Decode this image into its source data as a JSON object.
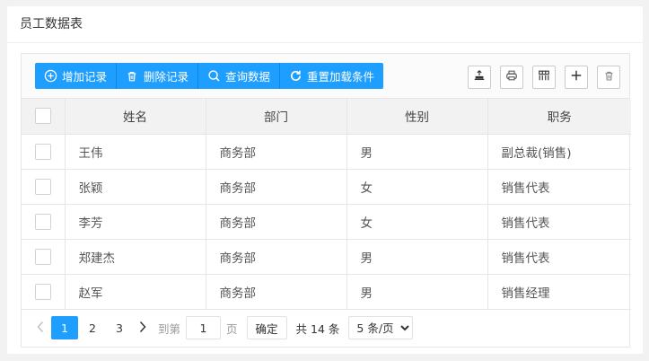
{
  "card": {
    "title": "员工数据表"
  },
  "toolbar": {
    "buttons": [
      {
        "label": "增加记录",
        "icon": "plus-circle-icon"
      },
      {
        "label": "删除记录",
        "icon": "trash-icon"
      },
      {
        "label": "查询数据",
        "icon": "search-icon"
      },
      {
        "label": "重置加载条件",
        "icon": "refresh-icon"
      }
    ],
    "tools": [
      "export-icon",
      "print-icon",
      "columns-icon",
      "add-icon",
      "delete-icon"
    ]
  },
  "table": {
    "columns": [
      "姓名",
      "部门",
      "性别",
      "职务"
    ],
    "rows": [
      {
        "name": "王伟",
        "dept": "商务部",
        "gender": "男",
        "title": "副总裁(销售)"
      },
      {
        "name": "张颖",
        "dept": "商务部",
        "gender": "女",
        "title": "销售代表"
      },
      {
        "name": "李芳",
        "dept": "商务部",
        "gender": "女",
        "title": "销售代表"
      },
      {
        "name": "郑建杰",
        "dept": "商务部",
        "gender": "男",
        "title": "销售代表"
      },
      {
        "name": "赵军",
        "dept": "商务部",
        "gender": "男",
        "title": "销售经理"
      }
    ]
  },
  "pager": {
    "pages": [
      "1",
      "2",
      "3"
    ],
    "current": "1",
    "goto_label": "到第",
    "goto_value": "1",
    "page_unit": "页",
    "confirm_label": "确定",
    "total_label": "共 14 条",
    "page_size": "5 条/页"
  },
  "colors": {
    "accent": "#1e9fff"
  }
}
